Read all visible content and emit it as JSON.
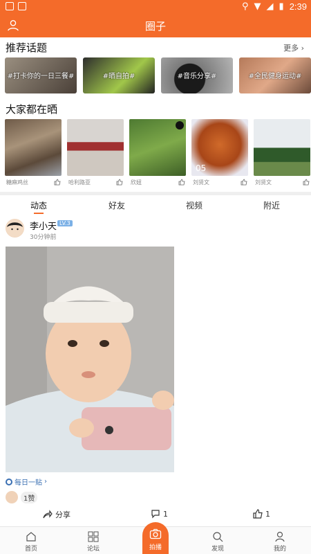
{
  "status_bar": {
    "time": "2:39"
  },
  "app_bar": {
    "title": "圈子"
  },
  "recommend": {
    "title": "推荐话题",
    "more": "更多",
    "topics": [
      "#打卡你的一日三餐#",
      "#晒自拍#",
      "#音乐分享#",
      "#全民健身运动#"
    ]
  },
  "everyone": {
    "title": "大家都在晒",
    "items": [
      {
        "name": "糖麻鸡丝",
        "badge": ""
      },
      {
        "name": "哈利路亚",
        "badge": ""
      },
      {
        "name": "欣妞",
        "badge": ""
      },
      {
        "name": "刘贤文",
        "badge": "05"
      },
      {
        "name": "刘贤文",
        "badge": ""
      }
    ]
  },
  "tabs": [
    "动态",
    "好友",
    "视频",
    "附近"
  ],
  "active_tab": "动态",
  "post": {
    "author": "李小天",
    "level": "LV.3",
    "time": "30分钟前",
    "tag": "每日一贴",
    "likes_label": "1赞",
    "share_label": "分享",
    "comment_count": "1",
    "like_count": "1"
  },
  "bottom_nav": {
    "home": "首页",
    "forum": "论坛",
    "shoot": "拍播",
    "discover": "发现",
    "mine": "我的"
  },
  "colors": {
    "accent": "#f46b2a",
    "link": "#3a6fb2"
  }
}
